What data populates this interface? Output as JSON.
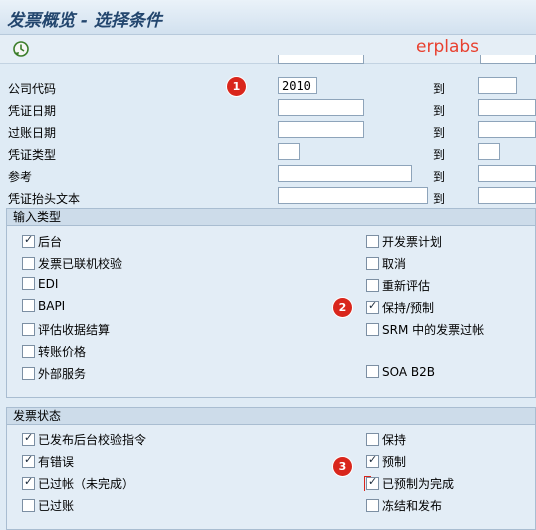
{
  "title": "发票概览 - 选择条件",
  "watermark": "erplabs",
  "toolbar": {
    "execute_icon": "execute-clock-icon"
  },
  "fields": {
    "company_code": {
      "label": "公司代码",
      "from": "2010",
      "to": ""
    },
    "doc_date": {
      "label": "凭证日期",
      "from": "",
      "to": ""
    },
    "posting_date": {
      "label": "过账日期",
      "from": "",
      "to": ""
    },
    "doc_type": {
      "label": "凭证类型",
      "from": "",
      "to": ""
    },
    "reference": {
      "label": "参考",
      "from": "",
      "to": ""
    },
    "header_text": {
      "label": "凭证抬头文本",
      "from": "",
      "to": ""
    },
    "to_label": "到"
  },
  "annotations": [
    "1",
    "2",
    "3"
  ],
  "input_type": {
    "header": "输入类型",
    "left": [
      {
        "label": "后台",
        "checked": true
      },
      {
        "label": "发票已联机校验",
        "checked": false
      },
      {
        "label": "EDI",
        "checked": false
      },
      {
        "label": "BAPI",
        "checked": false
      },
      {
        "label": "评估收据结算",
        "checked": false
      },
      {
        "label": "转账价格",
        "checked": false
      },
      {
        "label": "外部服务",
        "checked": false
      }
    ],
    "right": [
      {
        "label": "开发票计划",
        "checked": false
      },
      {
        "label": "取消",
        "checked": false
      },
      {
        "label": "重新评估",
        "checked": false
      },
      {
        "label": "保持/预制",
        "checked": true
      },
      {
        "label": "SRM 中的发票过帐",
        "checked": false
      },
      {
        "label": "SOA B2B",
        "checked": false
      }
    ]
  },
  "invoice_status": {
    "header": "发票状态",
    "left": [
      {
        "label": "已发布后台校验指令",
        "checked": true
      },
      {
        "label": "有错误",
        "checked": true
      },
      {
        "label": "已过帐（未完成）",
        "checked": true
      },
      {
        "label": "已过账",
        "checked": false
      }
    ],
    "right": [
      {
        "label": "保持",
        "checked": false
      },
      {
        "label": "预制",
        "checked": true
      },
      {
        "label": "已预制为完成",
        "checked": true
      },
      {
        "label": "冻结和发布",
        "checked": false
      }
    ]
  }
}
